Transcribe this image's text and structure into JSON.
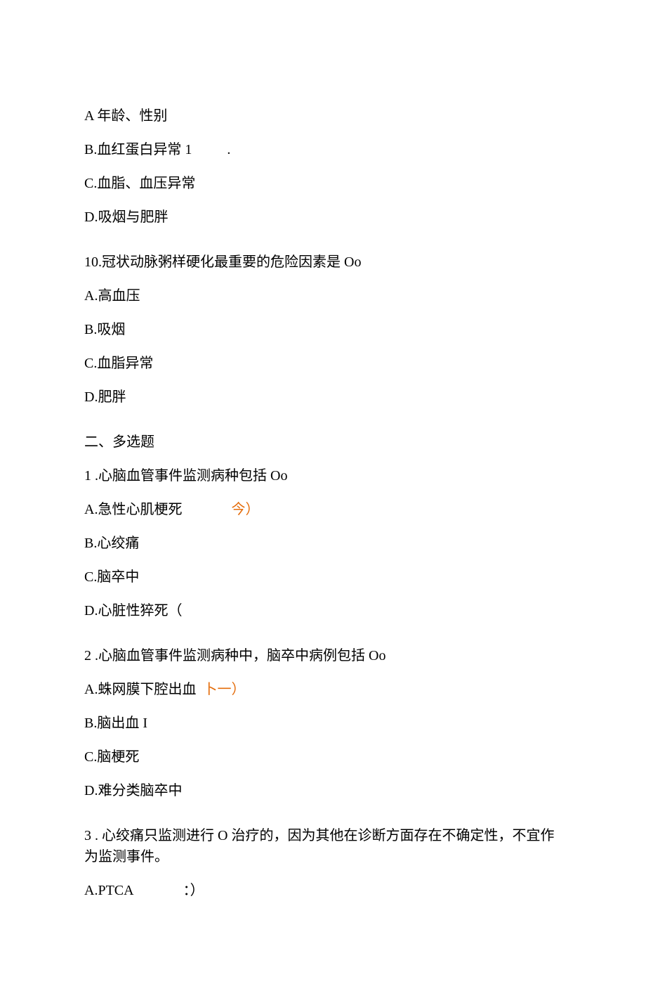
{
  "q_prev": {
    "options": {
      "a": "A 年龄、性别",
      "b": "B.血红蛋白异常 1",
      "b_dot": ".",
      "c": "C.血脂、血压异常",
      "d": "D.吸烟与肥胖"
    }
  },
  "q10": {
    "stem": "10.冠状动脉粥样硬化最重要的危险因素是 Oo",
    "options": {
      "a": "A.高血压",
      "b": "B.吸烟",
      "c": "C.血脂异常",
      "d": "D.肥胖"
    }
  },
  "section2": {
    "heading": "二、多选题"
  },
  "m1": {
    "stem": "1 .心脑血管事件监测病种包括 Oo",
    "options": {
      "a_text": "A.急性心肌梗死",
      "a_annot": "今）",
      "b": "B.心绞痛",
      "c": "C.脑卒中",
      "d": "D.心脏性猝死（"
    }
  },
  "m2": {
    "stem": "2 .心脑血管事件监测病种中，脑卒中病例包括 Oo",
    "options": {
      "a_text": "A.蛛网膜下腔出血",
      "a_annot": "卜一）",
      "b": "B.脑出血 I",
      "c": "C.脑梗死",
      "d": "D.难分类脑卒中"
    }
  },
  "m3": {
    "stem": "3 . 心绞痛只监测进行 O 治疗的，因为其他在诊断方面存在不确定性，不宜作为监测事件。",
    "options": {
      "a_text": "A.PTCA",
      "a_annot": "：）"
    }
  }
}
